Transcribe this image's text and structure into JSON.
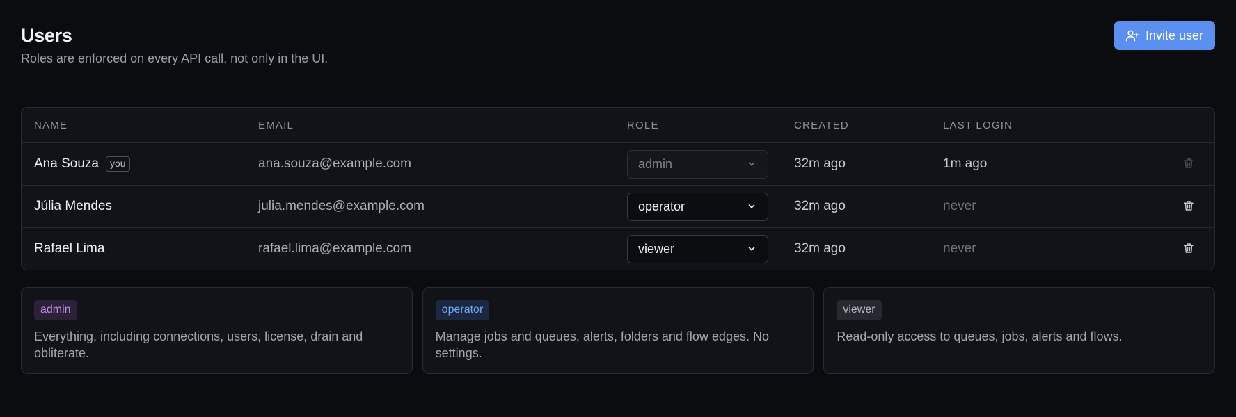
{
  "header": {
    "title": "Users",
    "subtitle": "Roles are enforced on every API call, not only in the UI.",
    "invite_label": "Invite user"
  },
  "table": {
    "columns": [
      "NAME",
      "EMAIL",
      "ROLE",
      "CREATED",
      "LAST LOGIN"
    ],
    "rows": [
      {
        "name": "Ana Souza",
        "badge": "you",
        "email": "ana.souza@example.com",
        "role": "admin",
        "role_editable": false,
        "created": "32m ago",
        "last_login": "1m ago"
      },
      {
        "name": "Júlia Mendes",
        "email": "julia.mendes@example.com",
        "role": "operator",
        "role_editable": true,
        "created": "32m ago",
        "last_login": "never"
      },
      {
        "name": "Rafael Lima",
        "email": "rafael.lima@example.com",
        "role": "viewer",
        "role_editable": true,
        "created": "32m ago",
        "last_login": "never"
      }
    ]
  },
  "roles": [
    {
      "label": "admin",
      "description": "Everything, including connections, users, license, drain and obliterate.",
      "text_color": "#c58af0",
      "bg_color": "#2b2238"
    },
    {
      "label": "operator",
      "description": "Manage jobs and queues, alerts, folders and flow edges. No settings.",
      "text_color": "#6ea8f5",
      "bg_color": "#1c2840"
    },
    {
      "label": "viewer",
      "description": "Read-only access to queues, jobs, alerts and flows.",
      "text_color": "#b3b8c0",
      "bg_color": "#262930"
    }
  ],
  "colors": {
    "accent": "#5b8ff0",
    "background": "#0b0c10",
    "card": "#111318"
  },
  "icons": {
    "invite": "user-plus-icon",
    "dropdown": "chevron-down-icon",
    "delete": "trash-icon"
  }
}
